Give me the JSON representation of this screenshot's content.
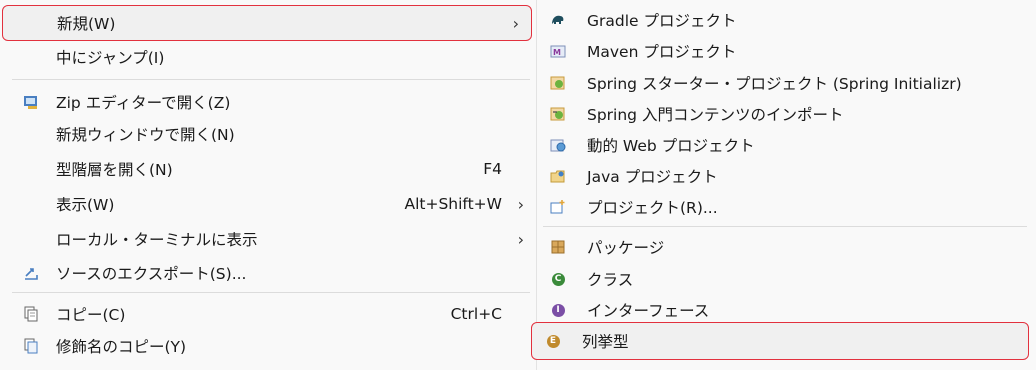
{
  "main_menu": {
    "new": {
      "label": "新規(W)"
    },
    "goto": {
      "label": "中にジャンプ(I)"
    },
    "zip_editor": {
      "label": "Zip エディターで開く(Z)"
    },
    "new_window": {
      "label": "新規ウィンドウで開く(N)"
    },
    "type_hierarchy": {
      "label": "型階層を開く(N)",
      "shortcut": "F4"
    },
    "show": {
      "label": "表示(W)",
      "shortcut": "Alt+Shift+W"
    },
    "local_terminal": {
      "label": "ローカル・ターミナルに表示"
    },
    "export_source": {
      "label": "ソースのエクスポート(S)..."
    },
    "copy": {
      "label": "コピー(C)",
      "shortcut": "Ctrl+C"
    },
    "copy_qualified": {
      "label": "修飾名のコピー(Y)"
    }
  },
  "sub_menu": {
    "gradle": {
      "label": "Gradle プロジェクト"
    },
    "maven": {
      "label": "Maven プロジェクト"
    },
    "spring_starter": {
      "label": "Spring スターター・プロジェクト (Spring Initializr)"
    },
    "spring_guides": {
      "label": "Spring 入門コンテンツのインポート"
    },
    "dynamic_web": {
      "label": "動的 Web プロジェクト"
    },
    "java_project": {
      "label": "Java プロジェクト"
    },
    "project": {
      "label": "プロジェクト(R)..."
    },
    "package": {
      "label": "パッケージ"
    },
    "class": {
      "label": "クラス"
    },
    "interface": {
      "label": "インターフェース"
    },
    "enum": {
      "label": "列挙型"
    }
  },
  "colors": {
    "highlight_border": "#e2313e",
    "menu_bg": "#f9f9f9"
  }
}
